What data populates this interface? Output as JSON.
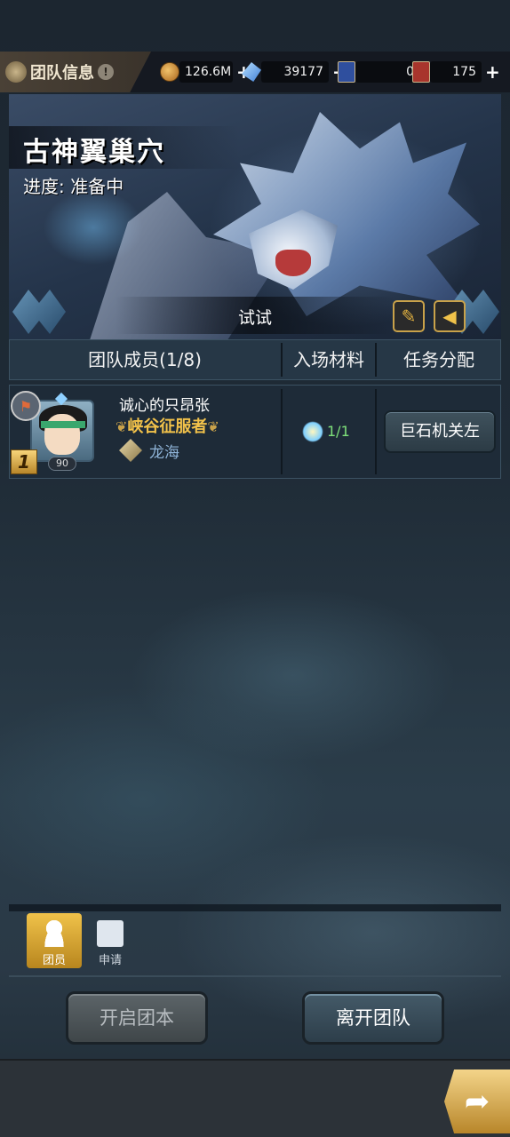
{
  "header": {
    "title": "团队信息",
    "info_icon": "!",
    "resources": [
      {
        "icon": "coin-icon",
        "value": "126.6M",
        "has_plus": true
      },
      {
        "icon": "crystal-icon",
        "value": "39177",
        "has_plus": true
      },
      {
        "icon": "blue-ticket-icon",
        "value": "0",
        "has_plus": false
      },
      {
        "icon": "red-ticket-icon",
        "value": "175",
        "has_plus": true
      }
    ],
    "plus_label": "+"
  },
  "raid": {
    "name": "古神翼巢穴",
    "progress": "进度: 准备中",
    "team_name": "试试"
  },
  "table": {
    "col_members": "团队成员(1/8)",
    "col_materials": "入场材料",
    "col_tasks": "任务分配"
  },
  "members": [
    {
      "name": "诚心的只昂张",
      "title": "峡谷征服者",
      "guild": "龙海",
      "level": "90",
      "rank": "1",
      "materials": "1/1",
      "task": "巨石机关左"
    }
  ],
  "tabs": {
    "members_label": "团员",
    "apply_label": "申请"
  },
  "buttons": {
    "start": "开启团本",
    "leave": "离开团队"
  },
  "colors": {
    "accent_gold": "#f0c24a",
    "material_green": "#7ee07a"
  }
}
